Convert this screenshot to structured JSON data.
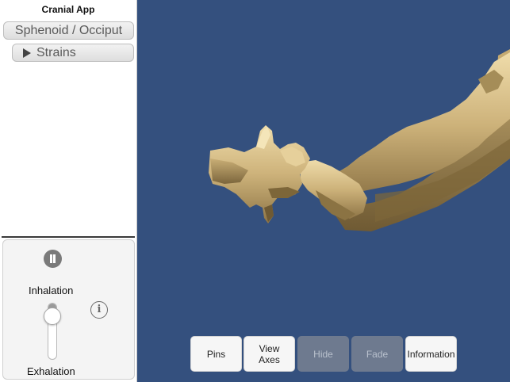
{
  "app": {
    "title": "Cranial App"
  },
  "sidebar": {
    "bone_selector_label": "Sphenoid / Occiput",
    "strains_label": "Strains"
  },
  "breathing": {
    "inhalation_label": "Inhalation",
    "exhalation_label": "Exhalation",
    "play_state": "pause-icon",
    "info_icon": "i",
    "slider_level": 0.1
  },
  "toolbar": {
    "pins_label": "Pins",
    "view_axes_label": "View\nAxes",
    "hide_label": "Hide",
    "fade_label": "Fade",
    "information_label": "Information"
  },
  "colors": {
    "viewport_bg": "#34507e",
    "bone": "#d8c18a",
    "disabled_button": "#6e7a8f"
  }
}
